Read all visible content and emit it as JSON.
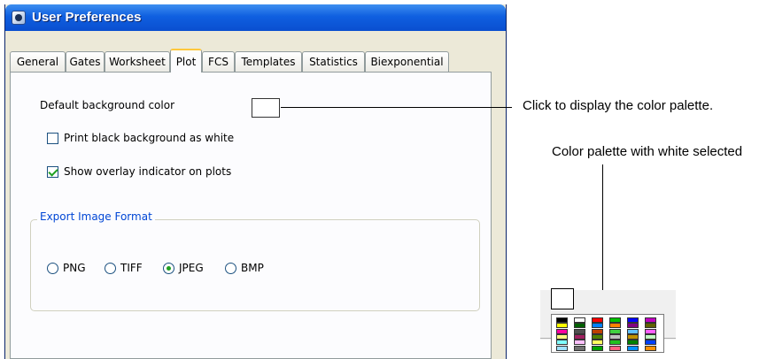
{
  "window": {
    "title": "User Preferences",
    "tabs": [
      {
        "label": "General",
        "active": false
      },
      {
        "label": "Gates",
        "active": false
      },
      {
        "label": "Worksheet",
        "active": false
      },
      {
        "label": "Plot",
        "active": true
      },
      {
        "label": "FCS",
        "active": false
      },
      {
        "label": "Templates",
        "active": false
      },
      {
        "label": "Statistics",
        "active": false
      },
      {
        "label": "Biexponential",
        "active": false
      }
    ]
  },
  "plot_tab": {
    "default_bg_label": "Default background color",
    "default_bg_value": "#ffffff",
    "print_black_label": "Print black background as white",
    "print_black_checked": false,
    "overlay_label": "Show overlay indicator on plots",
    "overlay_checked": true,
    "export_group_title": "Export Image Format",
    "export_options": [
      {
        "label": "PNG",
        "selected": false
      },
      {
        "label": "TIFF",
        "selected": false
      },
      {
        "label": "JPEG",
        "selected": true
      },
      {
        "label": "BMP",
        "selected": false
      }
    ]
  },
  "annotations": {
    "click_callout": "Click to display the color palette.",
    "palette_callout": "Color palette with white selected"
  },
  "palette": {
    "selected": "#ffffff",
    "rows": [
      [
        "#000000",
        "#ffffff",
        "#ff0000",
        "#00c000",
        "#0000ff",
        "#c000c0"
      ],
      [
        "#ffff00",
        "#006000",
        "#0080ff",
        "#ff8000",
        "#800080",
        "#606000"
      ],
      [
        "#ff00a0",
        "#505050",
        "#c04000",
        "#40d040",
        "#60c0ff",
        "#ff60ff"
      ],
      [
        "#ffff80",
        "#a02060",
        "#508000",
        "#c0c0c0",
        "#c09000",
        "#c0ffc0"
      ],
      [
        "#80ffff",
        "#ffc0ff",
        "#ffff60",
        "#20c020",
        "#008000",
        "#0040ff"
      ],
      [
        "#a0e0ff",
        "#707070",
        "#00a000",
        "#ff6080",
        "#0090ff",
        "#ff9000"
      ]
    ]
  }
}
